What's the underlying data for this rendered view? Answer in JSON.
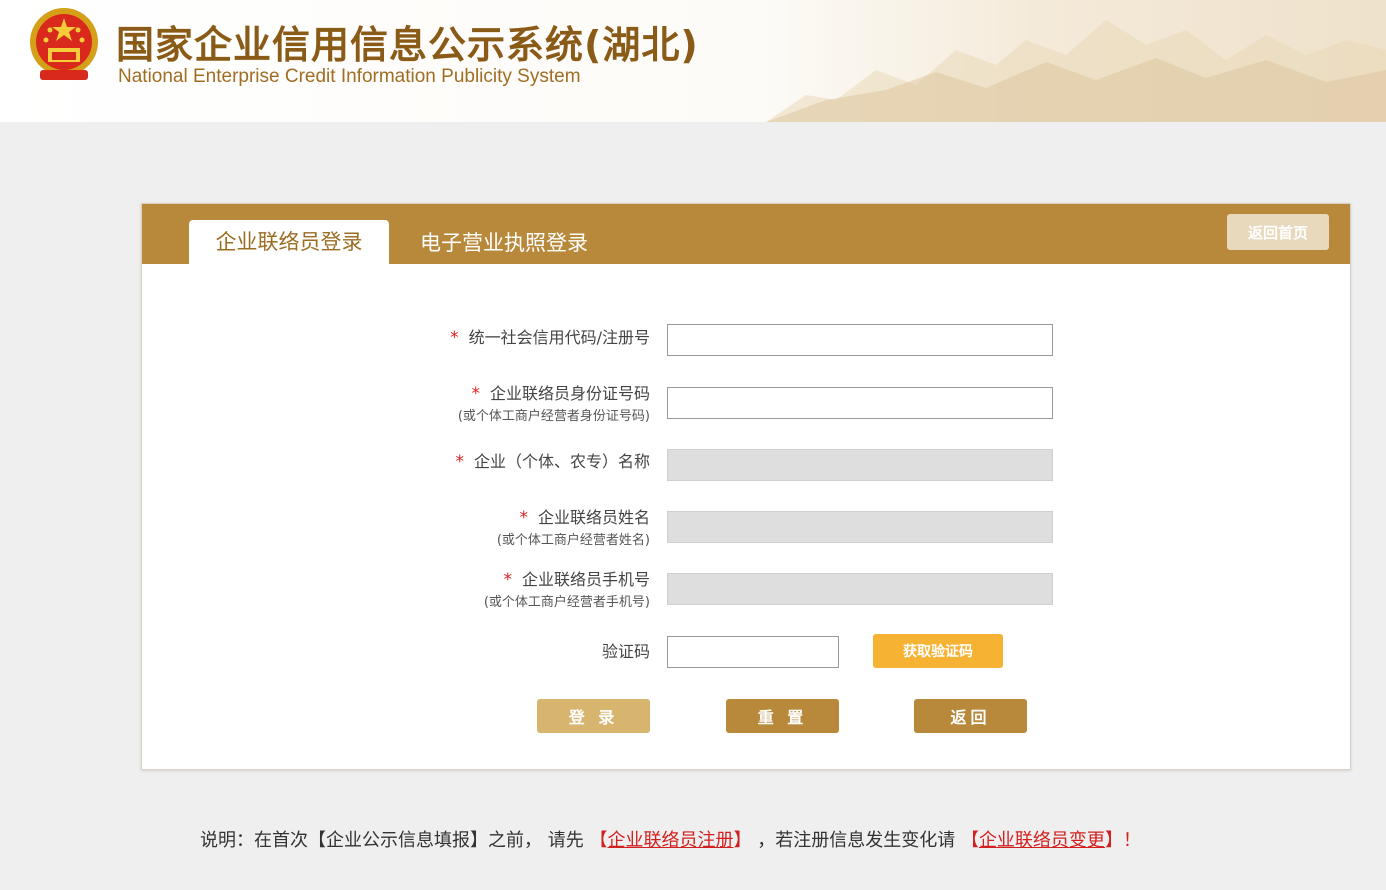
{
  "header": {
    "title": "国家企业信用信息公示系统(湖北)",
    "subtitle": "National Enterprise Credit Information Publicity System"
  },
  "tabs": {
    "active_label": "企业联络员登录",
    "inactive_label": "电子营业执照登录",
    "home_button": "返回首页"
  },
  "form": {
    "required_mark": "*",
    "credit_code_label": "统一社会信用代码/注册号",
    "id_number_label": "企业联络员身份证号码",
    "id_number_sublabel": "(或个体工商户经营者身份证号码)",
    "company_name_label": "企业（个体、农专）名称",
    "contact_name_label": "企业联络员姓名",
    "contact_name_sublabel": "(或个体工商户经营者姓名)",
    "phone_label": "企业联络员手机号",
    "phone_sublabel": "(或个体工商户经营者手机号)",
    "captcha_label": "验证码",
    "captcha_button": "获取验证码",
    "credit_code_value": "",
    "id_number_value": "",
    "company_name_value": "",
    "contact_name_value": "",
    "phone_value": "",
    "captcha_value": ""
  },
  "actions": {
    "login": "登 录",
    "reset": "重 置",
    "back": "返回"
  },
  "note": {
    "prefix": "说明：在首次【企业公示信息填报】之前，  请先",
    "bracket_open": "【",
    "bracket_close": "】",
    "register_link": "企业联络员注册",
    "middle": "，若注册信息发生变化请",
    "change_link": "企业联络员变更",
    "suffix": "！"
  },
  "colors": {
    "brand_gold": "#b8893a",
    "button_orange": "#f6b232",
    "required_red": "#e02020"
  }
}
